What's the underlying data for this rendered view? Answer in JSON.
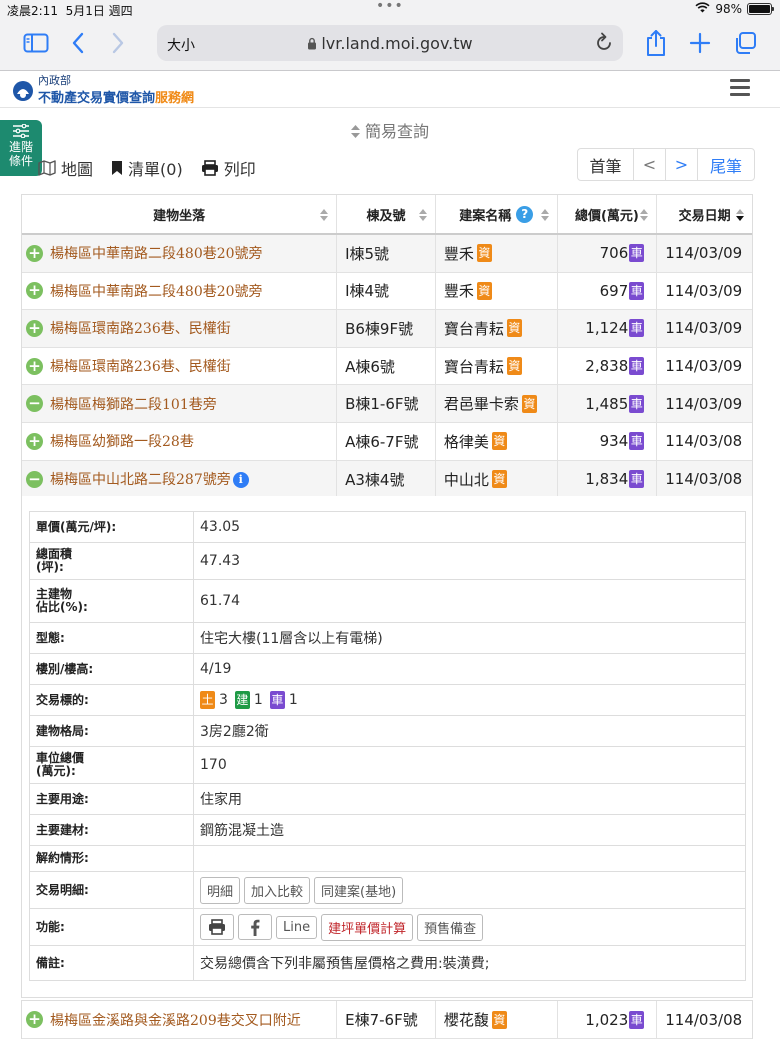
{
  "status": {
    "time": "凌晨2:11",
    "date": "5月1日 週四",
    "battery": "98%"
  },
  "browser": {
    "text_size_label": "大小",
    "url": "lvr.land.moi.gov.tw"
  },
  "site": {
    "logo_top": "內政部",
    "logo_main": "不動產交易實價查詢",
    "logo_accent": "服務網"
  },
  "sidebar_tab": {
    "line1": "進階",
    "line2": "條件"
  },
  "query": {
    "simple_label": "簡易查詢"
  },
  "toolbar": {
    "map": "地圖",
    "list": "清單(0)",
    "print": "列印"
  },
  "pager": {
    "first": "首筆",
    "prev": "<",
    "next": ">",
    "last": "尾筆"
  },
  "table": {
    "headers": {
      "address": "建物坐落",
      "building": "棟及號",
      "project": "建案名稱",
      "price": "總價(萬元)",
      "date": "交易日期"
    },
    "badge_zi": "資",
    "badge_che": "車",
    "rows": [
      {
        "address": "楊梅區中華南路二段480巷20號旁",
        "building": "I棟5號",
        "project": "豐禾",
        "price": "706",
        "date": "114/03/09"
      },
      {
        "address": "楊梅區中華南路二段480巷20號旁",
        "building": "I棟4號",
        "project": "豐禾",
        "price": "697",
        "date": "114/03/09"
      },
      {
        "address": "楊梅區環南路236巷、民權街",
        "building": "B6棟9F號",
        "project": "寶台青耘",
        "price": "1,124",
        "date": "114/03/09"
      },
      {
        "address": "楊梅區環南路236巷、民權街",
        "building": "A棟6號",
        "project": "寶台青耘",
        "price": "2,838",
        "date": "114/03/09"
      },
      {
        "address": "楊梅區梅獅路二段101巷旁",
        "building": "B棟1-6F號",
        "project": "君邑畢卡索",
        "price": "1,485",
        "date": "114/03/09"
      },
      {
        "address": "楊梅區幼獅路一段28巷",
        "building": "A棟6-7F號",
        "project": "格律美",
        "price": "934",
        "date": "114/03/08"
      },
      {
        "address": "楊梅區中山北路二段287號旁",
        "building": "A3棟4號",
        "project": "中山北",
        "price": "1,834",
        "date": "114/03/08"
      }
    ],
    "last_row": {
      "address": "楊梅區金溪路與金溪路209巷交叉口附近",
      "building": "E棟7-6F號",
      "project": "櫻花馥",
      "price": "1,023",
      "date": "114/03/08"
    }
  },
  "detail": {
    "unit_price_label": "單價(萬元/坪):",
    "unit_price": "43.05",
    "area_label_1": "總面積",
    "area_label_2": "(坪):",
    "area": "47.43",
    "main_ratio_label_1": "主建物",
    "main_ratio_label_2": "佔比(%):",
    "main_ratio": "61.74",
    "type_label": "型態:",
    "type": "住宅大樓(11層含以上有電梯)",
    "floor_label": "樓別/樓高:",
    "floor": "4/19",
    "target_label": "交易標的:",
    "target_tu": "土",
    "target_tu_count": "3",
    "target_jian": "建",
    "target_jian_count": "1",
    "target_che": "車",
    "target_che_count": "1",
    "layout_label": "建物格局:",
    "layout": "3房2廳2衛",
    "parking_label_1": "車位總價",
    "parking_label_2": "(萬元):",
    "parking": "170",
    "usage_label": "主要用途:",
    "usage": "住家用",
    "material_label": "主要建材:",
    "material": "鋼筋混凝土造",
    "termination_label": "解約情形:",
    "termination": "",
    "detail_label": "交易明細:",
    "btn_detail": "明細",
    "btn_compare": "加入比較",
    "btn_same": "同建案(基地)",
    "function_label": "功能:",
    "btn_line": "Line",
    "btn_calc": "建坪單價計算",
    "btn_presale": "預售備查",
    "note_label": "備註:",
    "note": "交易總價含下列非屬預售屋價格之費用:裝潢費;"
  }
}
